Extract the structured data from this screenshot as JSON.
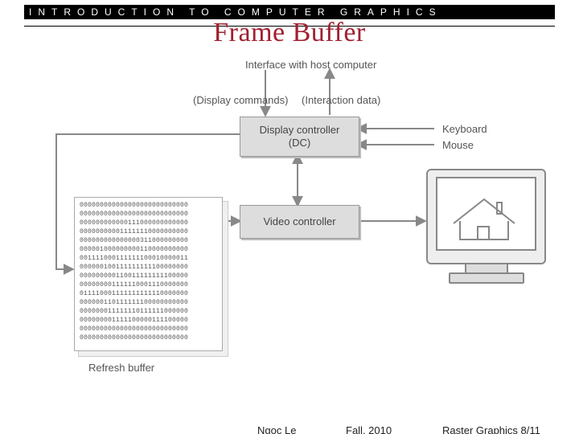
{
  "header": {
    "banner": "INTRODUCTION TO COMPUTER GRAPHICS",
    "title": "Frame Buffer"
  },
  "diagram": {
    "top_label": "Interface with host computer",
    "arrow_left_label": "(Display commands)",
    "arrow_right_label": "(Interaction data)",
    "box_dc_line1": "Display controller",
    "box_dc_line2": "(DC)",
    "box_vc": "Video controller",
    "kbd_label": "Keyboard",
    "mouse_label": "Mouse",
    "buffer_caption": "Refresh buffer",
    "buffer_rows": [
      "000000000000000000000000000",
      "000000000000000000000000000",
      "000000000000111000000000000",
      "000000000011111110000000000",
      "000000000000000311000000000",
      "000001000000000110000000000",
      "001111000111111100010000011",
      "000000100111111111100000000",
      "000000000110011111111100000",
      "000000001111110001110000000",
      "011110001111111111110000000",
      "000000110111111100000000000",
      "000000011111110111111000000",
      "000000001111100000111100000",
      "000000000000000000000000000",
      "000000000000000000000000000"
    ]
  },
  "footer": {
    "author": "Ngoc Le",
    "term": "Fall, 2010",
    "page": "Raster Graphics 8/11"
  }
}
